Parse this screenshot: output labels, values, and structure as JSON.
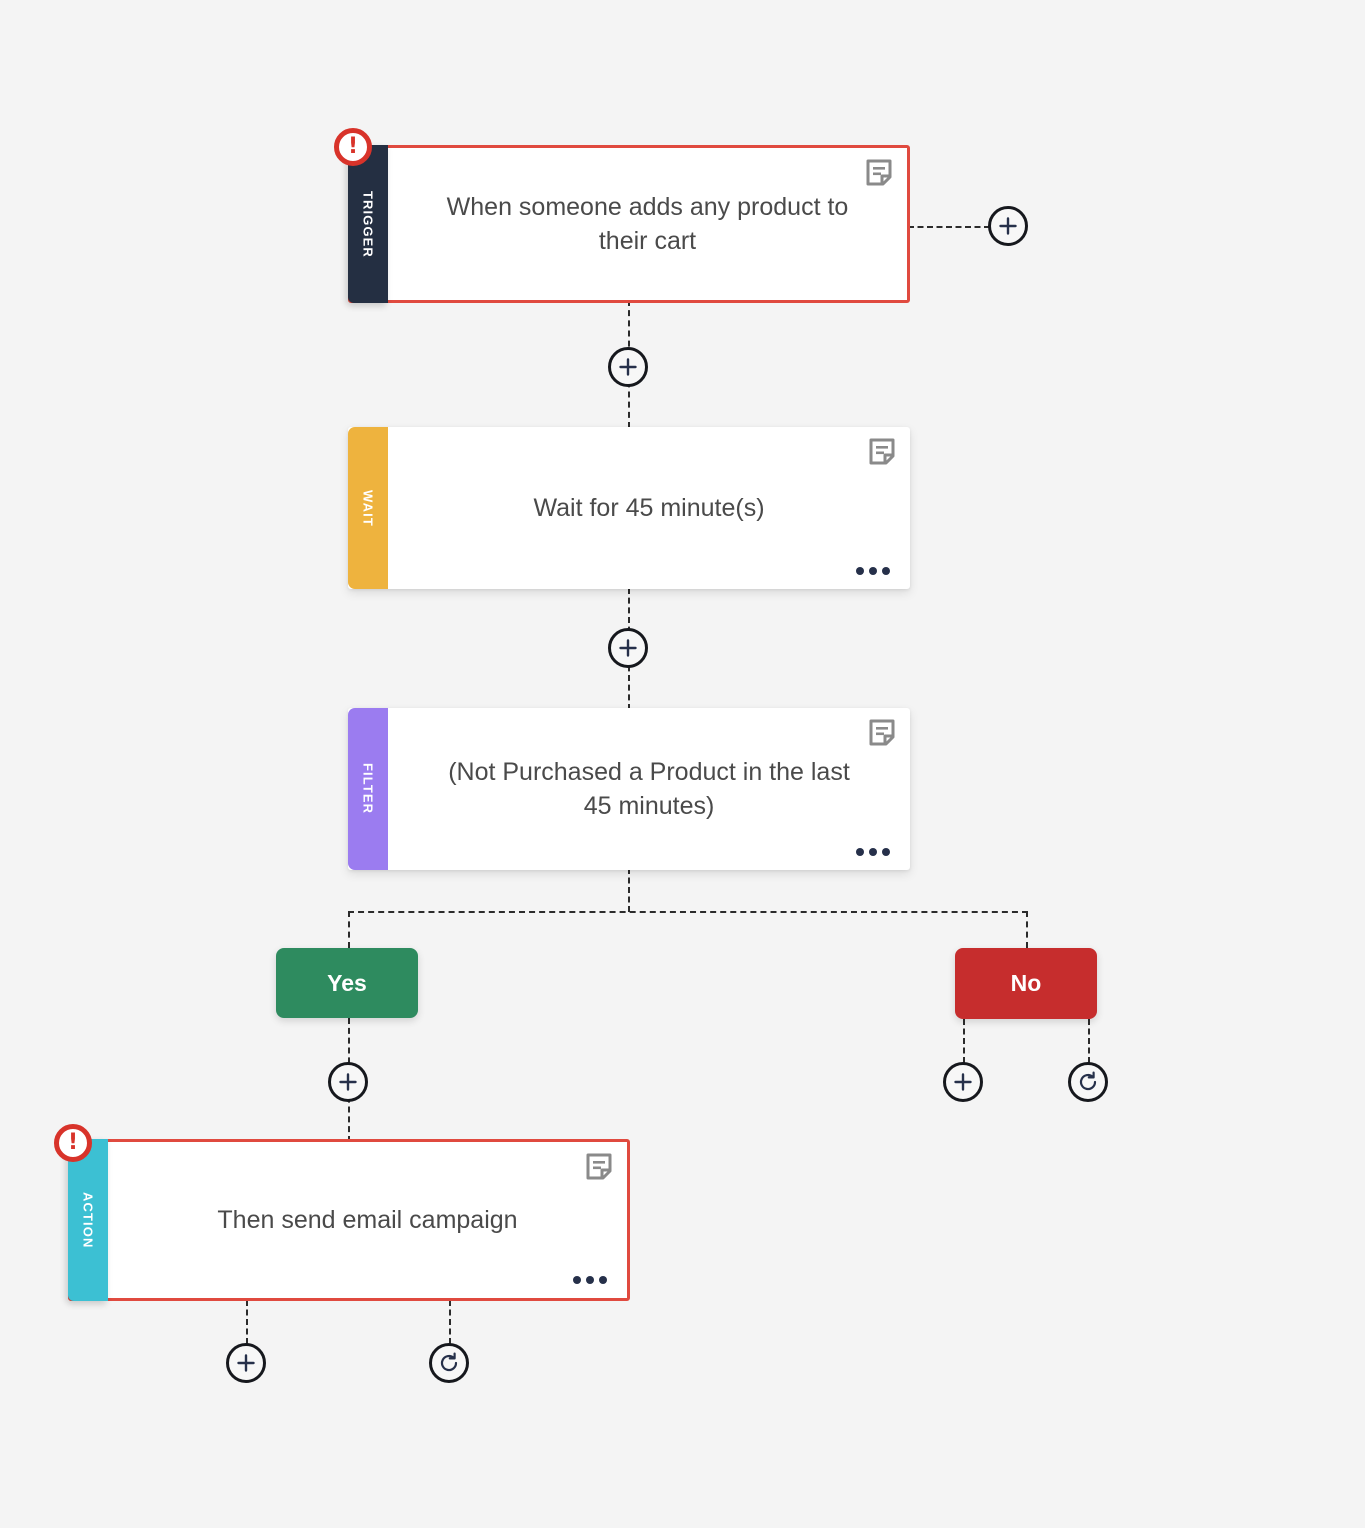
{
  "canvas": {
    "background": "#f4f4f4",
    "accent_error": "#e04a3f",
    "badge_red": "#d8332a"
  },
  "nodes": [
    {
      "id": "trigger",
      "kind_label": "TRIGGER",
      "kind_color": "#242f42",
      "title": "When someone adds any product to their cart",
      "has_error": true,
      "has_note": true,
      "has_menu": false,
      "note_icon": "note-icon",
      "error_icon": "alert-icon"
    },
    {
      "id": "wait",
      "kind_label": "WAIT",
      "kind_color": "#eeb33e",
      "title": "Wait for 45 minute(s)",
      "has_error": false,
      "has_note": true,
      "has_menu": true,
      "note_icon": "note-icon",
      "menu_icon": "ellipsis-icon"
    },
    {
      "id": "filter",
      "kind_label": "FILTER",
      "kind_color": "#9b7cf0",
      "title": "(Not Purchased a Product in the last 45 minutes)",
      "has_error": false,
      "has_note": true,
      "has_menu": true,
      "note_icon": "note-icon",
      "menu_icon": "ellipsis-icon"
    },
    {
      "id": "action",
      "kind_label": "ACTION",
      "kind_color": "#3cc0d3",
      "title": "Then send email campaign",
      "has_error": true,
      "has_note": true,
      "has_menu": true,
      "note_icon": "note-icon",
      "menu_icon": "ellipsis-icon",
      "error_icon": "alert-icon"
    }
  ],
  "branches": [
    {
      "id": "yes",
      "label": "Yes",
      "color": "#2e8b5f"
    },
    {
      "id": "no",
      "label": "No",
      "color": "#c62d2d"
    }
  ],
  "connector_buttons": [
    {
      "id": "trigger-right-add",
      "icon": "plus-icon",
      "glyph": "+"
    },
    {
      "id": "trigger-to-wait-add",
      "icon": "plus-icon",
      "glyph": "+"
    },
    {
      "id": "wait-to-filter-add",
      "icon": "plus-icon",
      "glyph": "+"
    },
    {
      "id": "yes-branch-add",
      "icon": "plus-icon",
      "glyph": "+"
    },
    {
      "id": "no-branch-add",
      "icon": "plus-icon",
      "glyph": "+"
    },
    {
      "id": "no-branch-retry",
      "icon": "refresh-icon",
      "glyph": "↻"
    },
    {
      "id": "action-add",
      "icon": "plus-icon",
      "glyph": "+"
    },
    {
      "id": "action-retry",
      "icon": "refresh-icon",
      "glyph": "↻"
    }
  ],
  "alert_glyph": "!"
}
